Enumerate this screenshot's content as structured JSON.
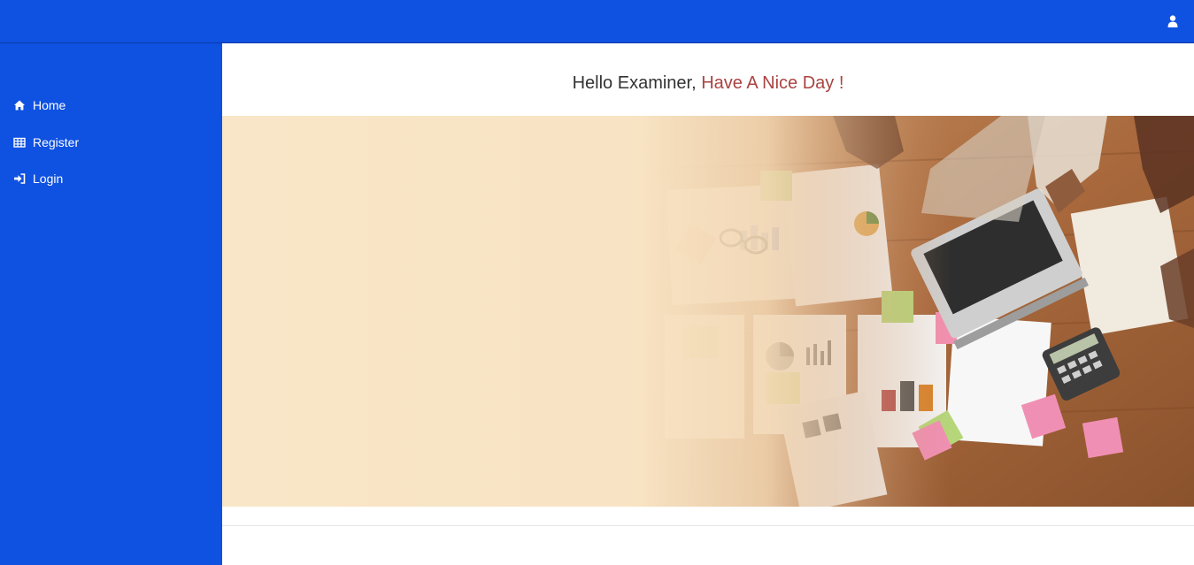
{
  "header": {
    "user_icon": "user-icon",
    "background": "#0f51e1"
  },
  "sidebar": {
    "background": "#0f51e1",
    "items": [
      {
        "label": "Home",
        "icon": "home-icon"
      },
      {
        "label": "Register",
        "icon": "table-icon"
      },
      {
        "label": "Login",
        "icon": "sign-in-icon"
      }
    ]
  },
  "main": {
    "greeting": {
      "prefix": "Hello Examiner, ",
      "accent": "Have A Nice Day !",
      "accent_color": "#a94442"
    }
  }
}
